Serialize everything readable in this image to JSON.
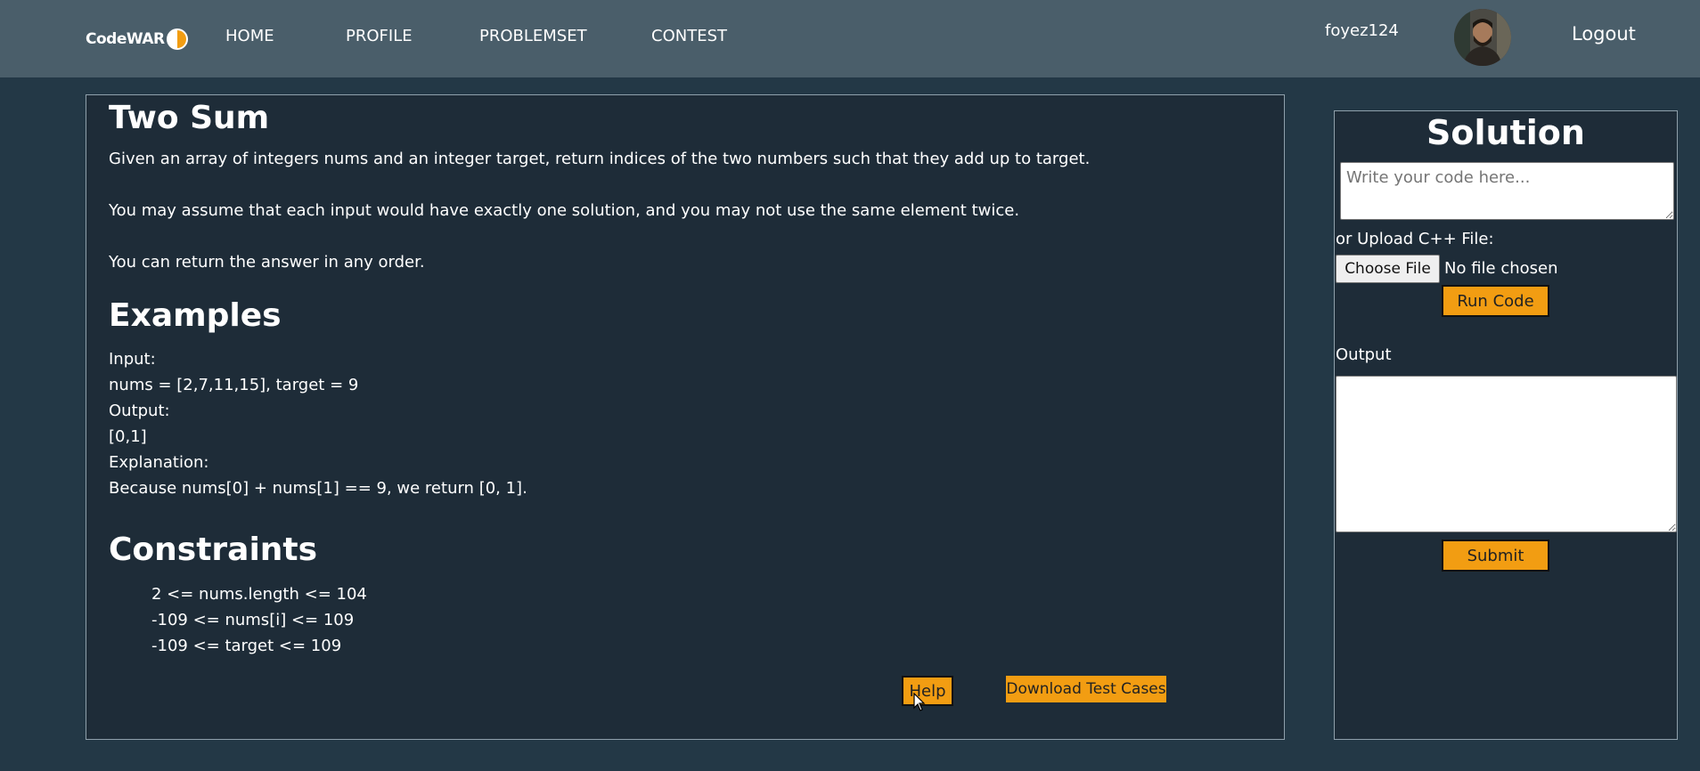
{
  "nav": {
    "logo_text": "CodeWAR",
    "links": [
      "HOME",
      "PROFILE",
      "PROBLEMSET",
      "CONTEST"
    ],
    "username": "foyez124",
    "logout": "Logout"
  },
  "problem": {
    "title": "Two Sum",
    "description": [
      "Given an array of integers nums and an integer target, return indices of the two numbers such that they add up to target.",
      "You may assume that each input would have exactly one solution, and you may not use the same element twice.",
      "You can return the answer in any order."
    ],
    "examples_heading": "Examples",
    "example": {
      "input_label": "Input:",
      "input_value": "nums = [2,7,11,15], target = 9",
      "output_label": "Output:",
      "output_value": "[0,1]",
      "explanation_label": "Explanation:",
      "explanation_value": "Because nums[0] + nums[1] == 9, we return [0, 1]."
    },
    "constraints_heading": "Constraints",
    "constraints": [
      "2 <= nums.length <= 104",
      "-109 <= nums[i] <= 109",
      "-109 <= target <= 109"
    ],
    "help_label": "Help",
    "download_label": "Download Test Cases"
  },
  "solution": {
    "title": "Solution",
    "code_placeholder": "Write your code here...",
    "upload_label": "or Upload C++ File:",
    "choose_file_label": "Choose File",
    "no_file_label": "No file chosen",
    "run_label": "Run Code",
    "output_label": "Output",
    "submit_label": "Submit"
  },
  "colors": {
    "navbar": "#4a5e6a",
    "background": "#233846",
    "panel": "#1e2c38",
    "accent_button": "#f29d12"
  }
}
